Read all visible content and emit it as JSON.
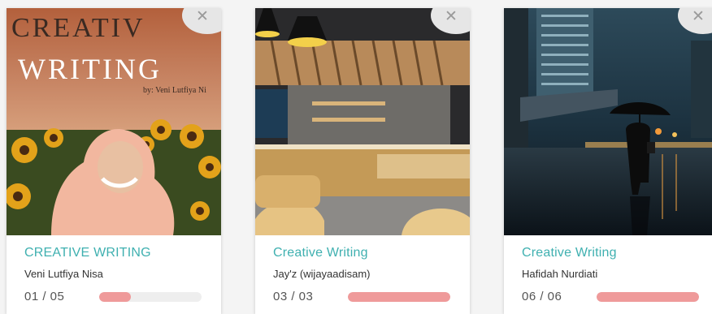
{
  "cards": [
    {
      "cover_title_line1": "CREATIV",
      "cover_title_line2": "WRITING",
      "cover_byline": "by: Veni Lutfiya Ni",
      "title": "CREATIVE WRITING",
      "author": "Veni Lutfiya Nisa",
      "progress_text": "01 / 05",
      "progress": 0.31
    },
    {
      "title": "Creative Writing",
      "author": "Jay'z (wijayaadisam)",
      "progress_text": "03 / 03",
      "progress": 1.0
    },
    {
      "title": "Creative Writing",
      "author": "Hafidah Nurdiati",
      "progress_text": "06 / 06",
      "progress": 1.0
    }
  ],
  "close_icon": "close-x-icon",
  "colors": {
    "title": "#3fb0b0",
    "progress_fill": "#ef9a9a",
    "progress_track": "#eeeeee"
  }
}
